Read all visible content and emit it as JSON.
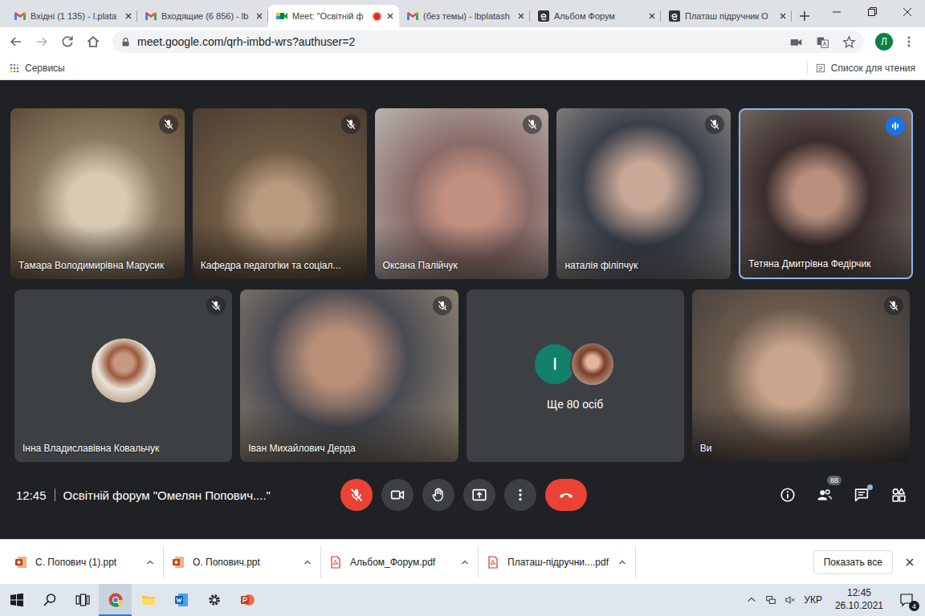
{
  "tabs": [
    {
      "label": "Вхідні (1 135) - l.plata",
      "kind": "gmail",
      "selected": false,
      "recording": false
    },
    {
      "label": "Входящие (6 856) - lb",
      "kind": "gmail",
      "selected": false,
      "recording": false
    },
    {
      "label": "Meet: \"Освітній ф",
      "kind": "meet",
      "selected": true,
      "recording": true
    },
    {
      "label": "(без темы) - lbplatash",
      "kind": "gmail",
      "selected": false,
      "recording": false
    },
    {
      "label": "Альбом Форум",
      "kind": "doc",
      "selected": false,
      "recording": false
    },
    {
      "label": "Платаш підручник О",
      "kind": "doc",
      "selected": false,
      "recording": false
    }
  ],
  "address": {
    "url": "meet.google.com/qrh-imbd-wrs?authuser=2",
    "profile_initial": "Л"
  },
  "bookmarks": {
    "items": [
      "Сервисы"
    ],
    "reading_list": "Список для чтения"
  },
  "meeting": {
    "tiles": [
      {
        "name": "Тамара Володимирівна Марусик",
        "kind": "video",
        "muted": true,
        "speaking": false,
        "initial": ""
      },
      {
        "name": "Кафедра педагогіки та соціал...",
        "kind": "video",
        "muted": true,
        "speaking": false,
        "initial": ""
      },
      {
        "name": "Оксана Палійчук",
        "kind": "video",
        "muted": true,
        "speaking": false,
        "initial": ""
      },
      {
        "name": "наталія філіпчук",
        "kind": "video",
        "muted": true,
        "speaking": false,
        "initial": ""
      },
      {
        "name": "Тетяна Дмитрівна Федірчик",
        "kind": "video",
        "muted": false,
        "speaking": true,
        "initial": ""
      },
      {
        "name": "Інна Владиславівна Ковальчук",
        "kind": "avatar",
        "muted": true,
        "speaking": false,
        "initial": ""
      },
      {
        "name": "Іван Михайлович Дерда",
        "kind": "video",
        "muted": true,
        "speaking": false,
        "initial": ""
      },
      {
        "name": "Ще 80 осіб",
        "kind": "overflow",
        "muted": false,
        "speaking": false,
        "initial": "І"
      },
      {
        "name": "Ви",
        "kind": "video",
        "muted": true,
        "speaking": false,
        "initial": ""
      }
    ],
    "time": "12:45",
    "title": "Освітній форум \"Омелян Попович....\"",
    "mic_muted": true,
    "participants_badge": "88",
    "chat_unread": true
  },
  "downloads": {
    "items": [
      {
        "name": "С. Попович (1).ppt",
        "kind": "ppt"
      },
      {
        "name": "О. Попович.ppt",
        "kind": "ppt"
      },
      {
        "name": "Альбом_Форум.pdf",
        "kind": "pdf"
      },
      {
        "name": "Платаш-підручни....pdf",
        "kind": "pdf"
      }
    ],
    "show_all": "Показать все"
  },
  "taskbar": {
    "apps": [
      {
        "kind": "start",
        "selected": false
      },
      {
        "kind": "search",
        "selected": false
      },
      {
        "kind": "taskview",
        "selected": false
      },
      {
        "kind": "chrome",
        "selected": true
      },
      {
        "kind": "explorer",
        "selected": false
      },
      {
        "kind": "word",
        "selected": false
      },
      {
        "kind": "settings",
        "selected": false
      },
      {
        "kind": "powerpoint",
        "selected": false
      }
    ],
    "language": "УКР",
    "time": "12:45",
    "date": "26.10.2021",
    "notifications": "4"
  }
}
